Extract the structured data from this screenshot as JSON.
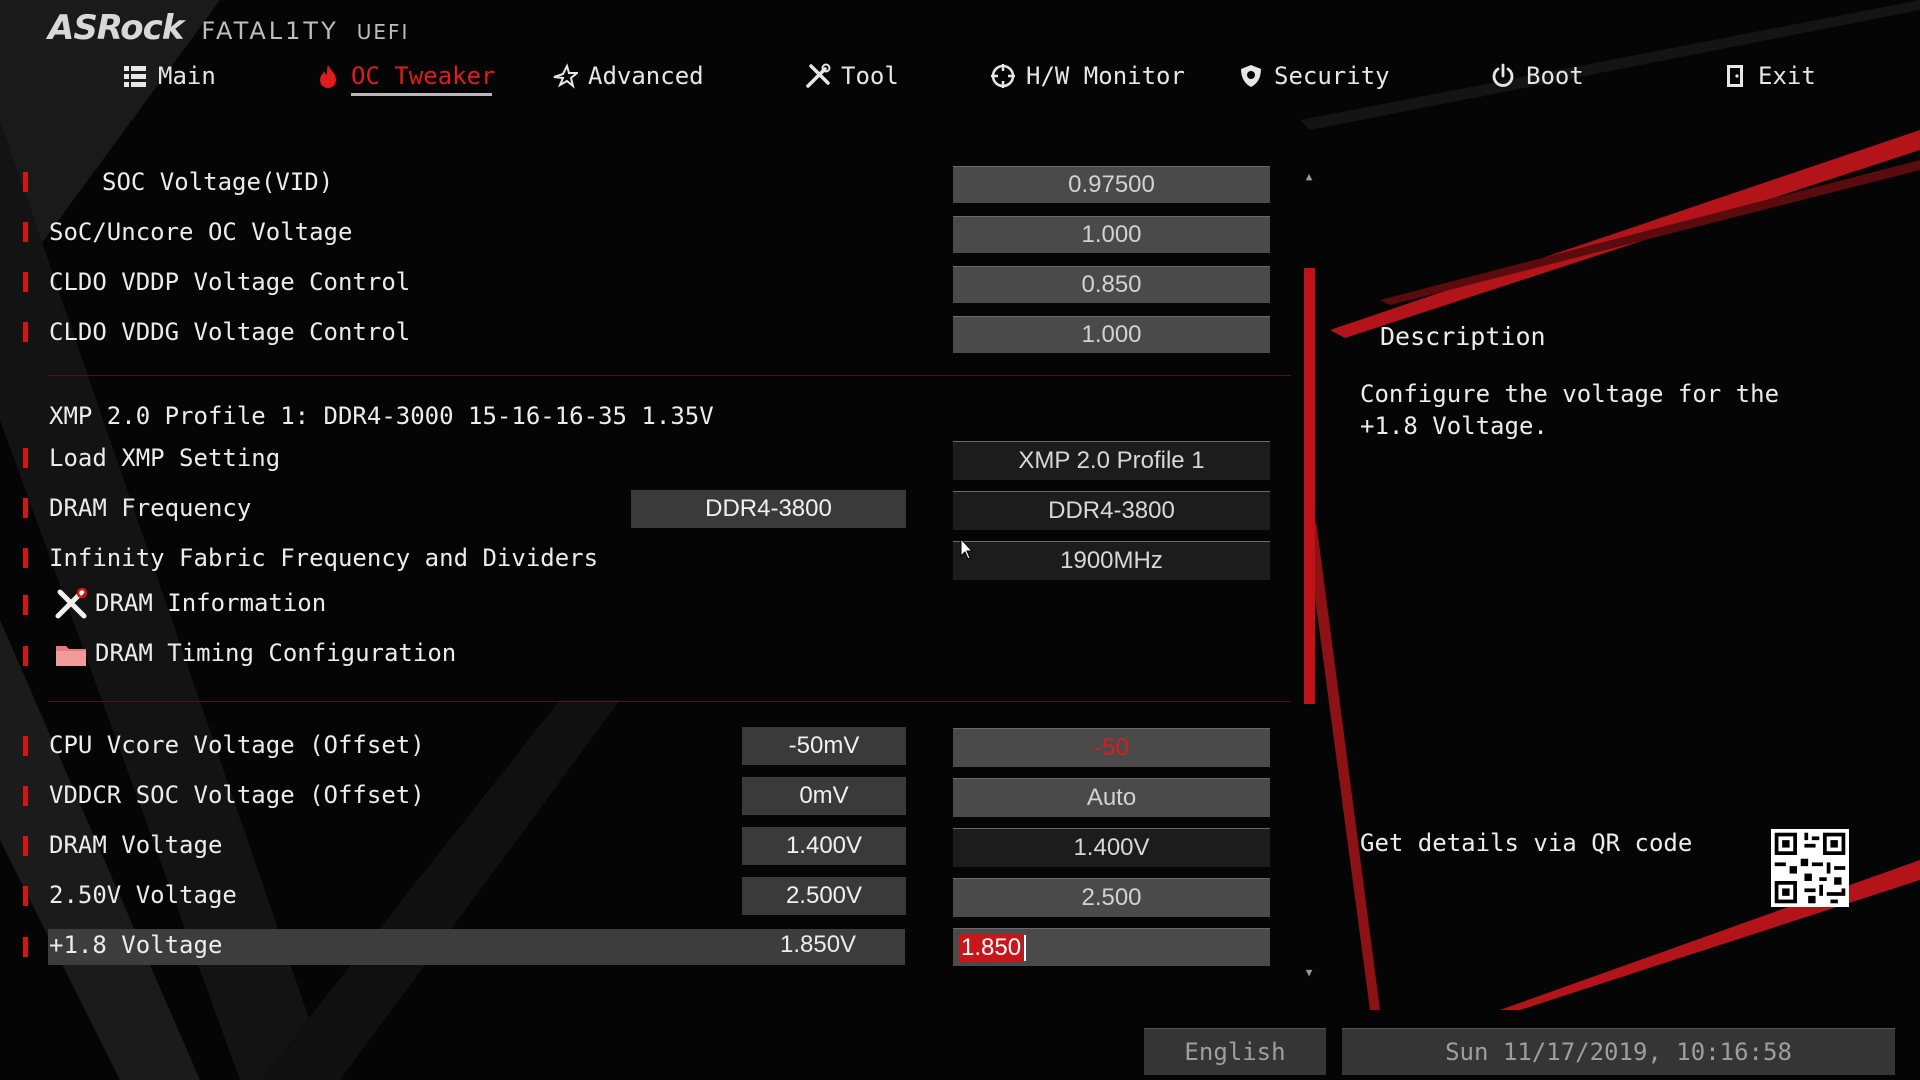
{
  "header": {
    "brand": "ASRock",
    "series": "FATAL1TY",
    "firmware": "UEFI"
  },
  "nav": {
    "tabs": [
      {
        "label": "Main",
        "icon": "list-icon",
        "active": false
      },
      {
        "label": "OC Tweaker",
        "icon": "flame-icon",
        "active": true
      },
      {
        "label": "Advanced",
        "icon": "star-icon",
        "active": false
      },
      {
        "label": "Tool",
        "icon": "tools-icon",
        "active": false
      },
      {
        "label": "H/W Monitor",
        "icon": "crosshair-icon",
        "active": false
      },
      {
        "label": "Security",
        "icon": "shield-icon",
        "active": false
      },
      {
        "label": "Boot",
        "icon": "power-icon",
        "active": false
      },
      {
        "label": "Exit",
        "icon": "exit-door-icon",
        "active": false
      }
    ]
  },
  "settings": {
    "soc_voltage_vid": {
      "label": "SOC Voltage(VID)",
      "value": "0.97500"
    },
    "soc_uncore_oc": {
      "label": "SoC/Uncore OC Voltage",
      "value": "1.000"
    },
    "cldo_vddp": {
      "label": "CLDO VDDP Voltage Control",
      "value": "0.850"
    },
    "cldo_vddg": {
      "label": "CLDO VDDG Voltage Control",
      "value": "1.000"
    },
    "xmp_profile_info": "XMP 2.0 Profile 1: DDR4-3000 15-16-16-35 1.35V",
    "load_xmp": {
      "label": "Load XMP Setting",
      "value": "XMP 2.0 Profile 1"
    },
    "dram_frequency": {
      "label": "DRAM Frequency",
      "current": "DDR4-3800",
      "value": "DDR4-3800"
    },
    "infinity_fabric": {
      "label": "Infinity Fabric Frequency and Dividers",
      "value": "1900MHz"
    },
    "dram_information": {
      "label": "DRAM Information",
      "icon": "tools-icon"
    },
    "dram_timing": {
      "label": "DRAM Timing Configuration",
      "icon": "folder-icon"
    },
    "cpu_vcore_offset": {
      "label": "CPU Vcore Voltage (Offset)",
      "current": "-50mV",
      "value": "-50"
    },
    "vddcr_soc_offset": {
      "label": "VDDCR SOC Voltage (Offset)",
      "current": "0mV",
      "value": "Auto"
    },
    "dram_voltage": {
      "label": "DRAM Voltage",
      "current": "1.400V",
      "value": "1.400V"
    },
    "v250_voltage": {
      "label": "2.50V Voltage",
      "current": "2.500V",
      "value": "2.500"
    },
    "v18_voltage": {
      "label": "+1.8 Voltage",
      "current": "1.850V",
      "value": "1.850"
    }
  },
  "description": {
    "title": "Description",
    "text": "Configure the voltage for the +1.8 Voltage.",
    "qr_label": "Get details via QR code"
  },
  "footer": {
    "language": "English",
    "datetime": "Sun 11/17/2019, 10:16:58"
  },
  "colors": {
    "accent": "#d31515",
    "background": "#050505",
    "value_box": "#4a4a4a",
    "selected_row": "#3d3d3d"
  }
}
